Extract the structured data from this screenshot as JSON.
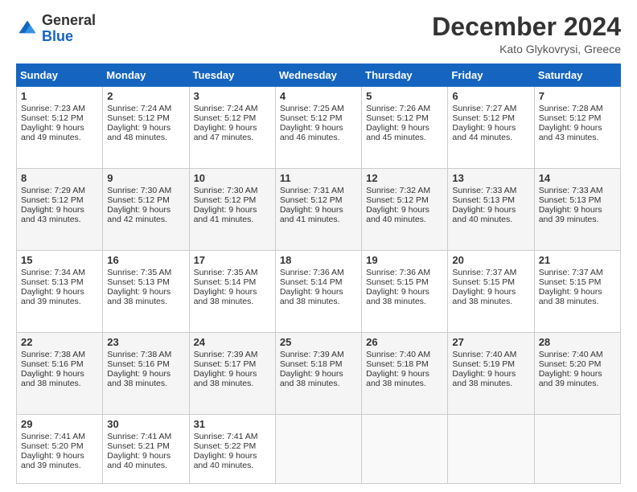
{
  "header": {
    "logo_general": "General",
    "logo_blue": "Blue",
    "month_title": "December 2024",
    "location": "Kato Glykovrysi, Greece"
  },
  "days_of_week": [
    "Sunday",
    "Monday",
    "Tuesday",
    "Wednesday",
    "Thursday",
    "Friday",
    "Saturday"
  ],
  "weeks": [
    [
      {
        "day": 1,
        "sunrise": "7:23 AM",
        "sunset": "5:12 PM",
        "daylight": "9 hours and 49 minutes."
      },
      {
        "day": 2,
        "sunrise": "7:24 AM",
        "sunset": "5:12 PM",
        "daylight": "9 hours and 48 minutes."
      },
      {
        "day": 3,
        "sunrise": "7:24 AM",
        "sunset": "5:12 PM",
        "daylight": "9 hours and 47 minutes."
      },
      {
        "day": 4,
        "sunrise": "7:25 AM",
        "sunset": "5:12 PM",
        "daylight": "9 hours and 46 minutes."
      },
      {
        "day": 5,
        "sunrise": "7:26 AM",
        "sunset": "5:12 PM",
        "daylight": "9 hours and 45 minutes."
      },
      {
        "day": 6,
        "sunrise": "7:27 AM",
        "sunset": "5:12 PM",
        "daylight": "9 hours and 44 minutes."
      },
      {
        "day": 7,
        "sunrise": "7:28 AM",
        "sunset": "5:12 PM",
        "daylight": "9 hours and 43 minutes."
      }
    ],
    [
      {
        "day": 8,
        "sunrise": "7:29 AM",
        "sunset": "5:12 PM",
        "daylight": "9 hours and 43 minutes."
      },
      {
        "day": 9,
        "sunrise": "7:30 AM",
        "sunset": "5:12 PM",
        "daylight": "9 hours and 42 minutes."
      },
      {
        "day": 10,
        "sunrise": "7:30 AM",
        "sunset": "5:12 PM",
        "daylight": "9 hours and 41 minutes."
      },
      {
        "day": 11,
        "sunrise": "7:31 AM",
        "sunset": "5:12 PM",
        "daylight": "9 hours and 41 minutes."
      },
      {
        "day": 12,
        "sunrise": "7:32 AM",
        "sunset": "5:12 PM",
        "daylight": "9 hours and 40 minutes."
      },
      {
        "day": 13,
        "sunrise": "7:33 AM",
        "sunset": "5:13 PM",
        "daylight": "9 hours and 40 minutes."
      },
      {
        "day": 14,
        "sunrise": "7:33 AM",
        "sunset": "5:13 PM",
        "daylight": "9 hours and 39 minutes."
      }
    ],
    [
      {
        "day": 15,
        "sunrise": "7:34 AM",
        "sunset": "5:13 PM",
        "daylight": "9 hours and 39 minutes."
      },
      {
        "day": 16,
        "sunrise": "7:35 AM",
        "sunset": "5:13 PM",
        "daylight": "9 hours and 38 minutes."
      },
      {
        "day": 17,
        "sunrise": "7:35 AM",
        "sunset": "5:14 PM",
        "daylight": "9 hours and 38 minutes."
      },
      {
        "day": 18,
        "sunrise": "7:36 AM",
        "sunset": "5:14 PM",
        "daylight": "9 hours and 38 minutes."
      },
      {
        "day": 19,
        "sunrise": "7:36 AM",
        "sunset": "5:15 PM",
        "daylight": "9 hours and 38 minutes."
      },
      {
        "day": 20,
        "sunrise": "7:37 AM",
        "sunset": "5:15 PM",
        "daylight": "9 hours and 38 minutes."
      },
      {
        "day": 21,
        "sunrise": "7:37 AM",
        "sunset": "5:15 PM",
        "daylight": "9 hours and 38 minutes."
      }
    ],
    [
      {
        "day": 22,
        "sunrise": "7:38 AM",
        "sunset": "5:16 PM",
        "daylight": "9 hours and 38 minutes."
      },
      {
        "day": 23,
        "sunrise": "7:38 AM",
        "sunset": "5:16 PM",
        "daylight": "9 hours and 38 minutes."
      },
      {
        "day": 24,
        "sunrise": "7:39 AM",
        "sunset": "5:17 PM",
        "daylight": "9 hours and 38 minutes."
      },
      {
        "day": 25,
        "sunrise": "7:39 AM",
        "sunset": "5:18 PM",
        "daylight": "9 hours and 38 minutes."
      },
      {
        "day": 26,
        "sunrise": "7:40 AM",
        "sunset": "5:18 PM",
        "daylight": "9 hours and 38 minutes."
      },
      {
        "day": 27,
        "sunrise": "7:40 AM",
        "sunset": "5:19 PM",
        "daylight": "9 hours and 38 minutes."
      },
      {
        "day": 28,
        "sunrise": "7:40 AM",
        "sunset": "5:20 PM",
        "daylight": "9 hours and 39 minutes."
      }
    ],
    [
      {
        "day": 29,
        "sunrise": "7:41 AM",
        "sunset": "5:20 PM",
        "daylight": "9 hours and 39 minutes."
      },
      {
        "day": 30,
        "sunrise": "7:41 AM",
        "sunset": "5:21 PM",
        "daylight": "9 hours and 40 minutes."
      },
      {
        "day": 31,
        "sunrise": "7:41 AM",
        "sunset": "5:22 PM",
        "daylight": "9 hours and 40 minutes."
      },
      null,
      null,
      null,
      null
    ]
  ]
}
